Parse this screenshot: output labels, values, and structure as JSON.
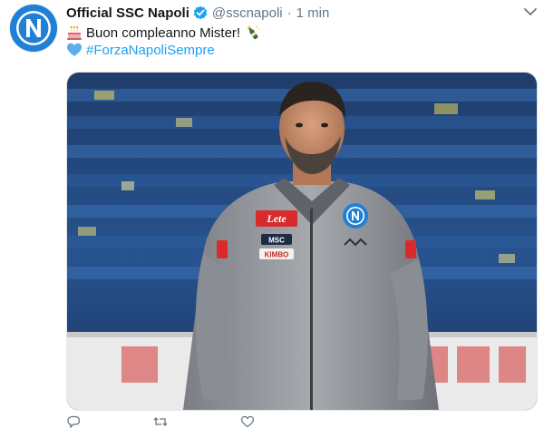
{
  "account": {
    "name": "Official SSC Napoli",
    "handle": "@sscnapoli",
    "separator": "·",
    "time": "1 min"
  },
  "tweet": {
    "text": "Buon compleanno Mister!",
    "hashtag": "#ForzaNapoliSempre"
  },
  "icons": {
    "verified": "verified-badge-icon",
    "caret": "chevron-down-icon",
    "cake": "birthday-cake-icon",
    "champagne": "champagne-bottle-icon",
    "heart": "blue-heart-icon",
    "reply": "reply-icon",
    "retweet": "retweet-icon",
    "like": "like-icon"
  },
  "photo": {
    "jacket_brands": [
      "Lete",
      "MSC",
      "KIMBO"
    ]
  },
  "colors": {
    "link": "#1da1f2",
    "napoli_blue": "#1a7fd4",
    "muted": "#657786"
  }
}
